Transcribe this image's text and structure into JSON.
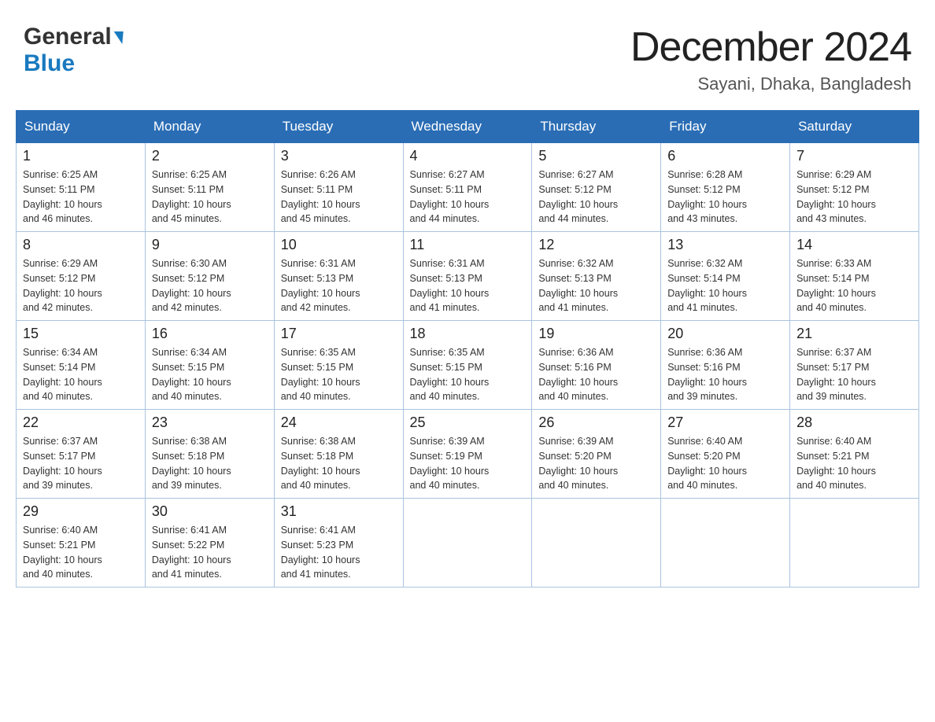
{
  "header": {
    "logo_general": "General",
    "logo_blue": "Blue",
    "month_title": "December 2024",
    "location": "Sayani, Dhaka, Bangladesh"
  },
  "days_of_week": [
    "Sunday",
    "Monday",
    "Tuesday",
    "Wednesday",
    "Thursday",
    "Friday",
    "Saturday"
  ],
  "weeks": [
    [
      {
        "day": "1",
        "sunrise": "6:25 AM",
        "sunset": "5:11 PM",
        "daylight": "10 hours and 46 minutes."
      },
      {
        "day": "2",
        "sunrise": "6:25 AM",
        "sunset": "5:11 PM",
        "daylight": "10 hours and 45 minutes."
      },
      {
        "day": "3",
        "sunrise": "6:26 AM",
        "sunset": "5:11 PM",
        "daylight": "10 hours and 45 minutes."
      },
      {
        "day": "4",
        "sunrise": "6:27 AM",
        "sunset": "5:11 PM",
        "daylight": "10 hours and 44 minutes."
      },
      {
        "day": "5",
        "sunrise": "6:27 AM",
        "sunset": "5:12 PM",
        "daylight": "10 hours and 44 minutes."
      },
      {
        "day": "6",
        "sunrise": "6:28 AM",
        "sunset": "5:12 PM",
        "daylight": "10 hours and 43 minutes."
      },
      {
        "day": "7",
        "sunrise": "6:29 AM",
        "sunset": "5:12 PM",
        "daylight": "10 hours and 43 minutes."
      }
    ],
    [
      {
        "day": "8",
        "sunrise": "6:29 AM",
        "sunset": "5:12 PM",
        "daylight": "10 hours and 42 minutes."
      },
      {
        "day": "9",
        "sunrise": "6:30 AM",
        "sunset": "5:12 PM",
        "daylight": "10 hours and 42 minutes."
      },
      {
        "day": "10",
        "sunrise": "6:31 AM",
        "sunset": "5:13 PM",
        "daylight": "10 hours and 42 minutes."
      },
      {
        "day": "11",
        "sunrise": "6:31 AM",
        "sunset": "5:13 PM",
        "daylight": "10 hours and 41 minutes."
      },
      {
        "day": "12",
        "sunrise": "6:32 AM",
        "sunset": "5:13 PM",
        "daylight": "10 hours and 41 minutes."
      },
      {
        "day": "13",
        "sunrise": "6:32 AM",
        "sunset": "5:14 PM",
        "daylight": "10 hours and 41 minutes."
      },
      {
        "day": "14",
        "sunrise": "6:33 AM",
        "sunset": "5:14 PM",
        "daylight": "10 hours and 40 minutes."
      }
    ],
    [
      {
        "day": "15",
        "sunrise": "6:34 AM",
        "sunset": "5:14 PM",
        "daylight": "10 hours and 40 minutes."
      },
      {
        "day": "16",
        "sunrise": "6:34 AM",
        "sunset": "5:15 PM",
        "daylight": "10 hours and 40 minutes."
      },
      {
        "day": "17",
        "sunrise": "6:35 AM",
        "sunset": "5:15 PM",
        "daylight": "10 hours and 40 minutes."
      },
      {
        "day": "18",
        "sunrise": "6:35 AM",
        "sunset": "5:15 PM",
        "daylight": "10 hours and 40 minutes."
      },
      {
        "day": "19",
        "sunrise": "6:36 AM",
        "sunset": "5:16 PM",
        "daylight": "10 hours and 40 minutes."
      },
      {
        "day": "20",
        "sunrise": "6:36 AM",
        "sunset": "5:16 PM",
        "daylight": "10 hours and 39 minutes."
      },
      {
        "day": "21",
        "sunrise": "6:37 AM",
        "sunset": "5:17 PM",
        "daylight": "10 hours and 39 minutes."
      }
    ],
    [
      {
        "day": "22",
        "sunrise": "6:37 AM",
        "sunset": "5:17 PM",
        "daylight": "10 hours and 39 minutes."
      },
      {
        "day": "23",
        "sunrise": "6:38 AM",
        "sunset": "5:18 PM",
        "daylight": "10 hours and 39 minutes."
      },
      {
        "day": "24",
        "sunrise": "6:38 AM",
        "sunset": "5:18 PM",
        "daylight": "10 hours and 40 minutes."
      },
      {
        "day": "25",
        "sunrise": "6:39 AM",
        "sunset": "5:19 PM",
        "daylight": "10 hours and 40 minutes."
      },
      {
        "day": "26",
        "sunrise": "6:39 AM",
        "sunset": "5:20 PM",
        "daylight": "10 hours and 40 minutes."
      },
      {
        "day": "27",
        "sunrise": "6:40 AM",
        "sunset": "5:20 PM",
        "daylight": "10 hours and 40 minutes."
      },
      {
        "day": "28",
        "sunrise": "6:40 AM",
        "sunset": "5:21 PM",
        "daylight": "10 hours and 40 minutes."
      }
    ],
    [
      {
        "day": "29",
        "sunrise": "6:40 AM",
        "sunset": "5:21 PM",
        "daylight": "10 hours and 40 minutes."
      },
      {
        "day": "30",
        "sunrise": "6:41 AM",
        "sunset": "5:22 PM",
        "daylight": "10 hours and 41 minutes."
      },
      {
        "day": "31",
        "sunrise": "6:41 AM",
        "sunset": "5:23 PM",
        "daylight": "10 hours and 41 minutes."
      },
      null,
      null,
      null,
      null
    ]
  ],
  "labels": {
    "sunrise": "Sunrise:",
    "sunset": "Sunset:",
    "daylight": "Daylight:"
  }
}
